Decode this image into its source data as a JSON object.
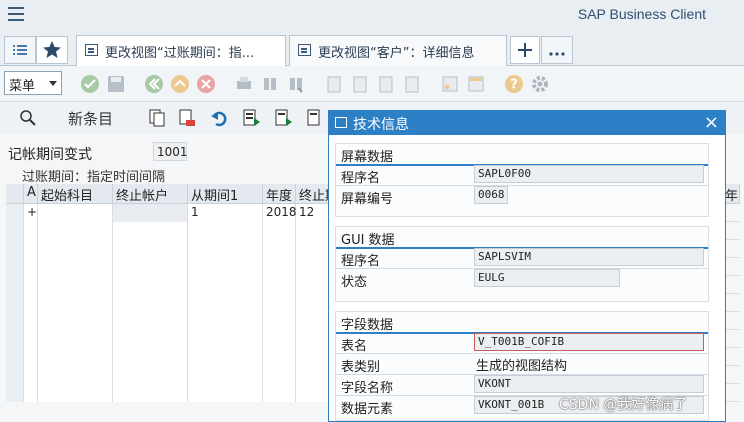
{
  "header": {
    "app_title": "SAP Business Client"
  },
  "tabs": [
    {
      "label": "更改视图“过账期间：指...",
      "active": true
    },
    {
      "label": "更改视图“客户”：详细信息",
      "active": false
    }
  ],
  "toolbar": {
    "menu_label": "菜单"
  },
  "app_toolbar": {
    "new_entries": "新条目"
  },
  "main": {
    "field_label": "记帐期间变式",
    "field_value": "1001",
    "table_title": "过账期间：指定时间间隔",
    "columns": [
      "A",
      "起始科目",
      "终止帐户",
      "从期间1",
      "年度",
      "终止期",
      "年"
    ],
    "row1": {
      "a": "+",
      "period": "1",
      "year": "2018",
      "to": "12"
    }
  },
  "dialog": {
    "title": "技术信息",
    "close": "×",
    "screen_group": {
      "title": "屏幕数据",
      "program_label": "程序名",
      "program_value": "SAPL0F00",
      "screen_no_label": "屏幕编号",
      "screen_no_value": "0068"
    },
    "gui_group": {
      "title": "GUI 数据",
      "program_label": "程序名",
      "program_value": "SAPLSVIM",
      "status_label": "状态",
      "status_value": "EULG"
    },
    "field_group": {
      "title": "字段数据",
      "table_label": "表名",
      "table_value": "V_T001B_COFIB",
      "table_type_label": "表类别",
      "table_type_value": "生成的视图结构",
      "field_label": "字段名称",
      "field_value": "VKONT",
      "element_label": "数据元素",
      "element_value": "VKONT_001B"
    }
  },
  "watermark": "CSDN @我好像病了",
  "colors": {
    "accent": "#2e80c6",
    "header_bg": "#e9eef3"
  }
}
